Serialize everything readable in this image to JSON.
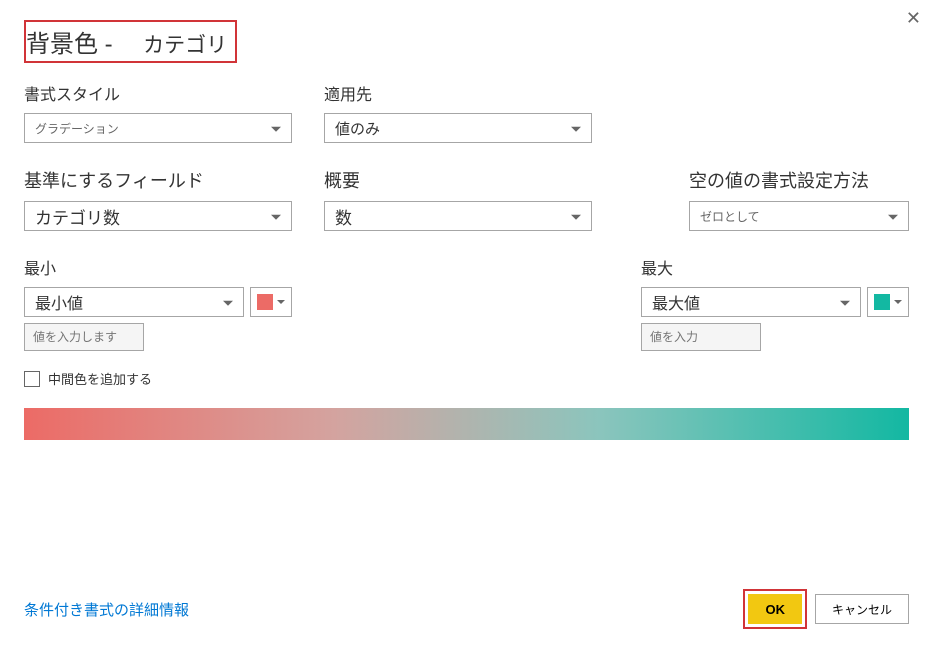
{
  "dialog": {
    "title_main": "背景色 -",
    "title_sub": "カテゴリ"
  },
  "row1": {
    "format_style": {
      "label": "書式スタイル",
      "value": "グラデーション"
    },
    "apply_to": {
      "label": "適用先",
      "value": "値のみ"
    }
  },
  "row2": {
    "base_field": {
      "label": "基準にするフィールド",
      "value": "カテゴリ数"
    },
    "summary": {
      "label": "概要",
      "value": "数"
    },
    "empty_format": {
      "label": "空の値の書式設定方法",
      "value": "ゼロとして"
    }
  },
  "row3": {
    "min": {
      "label": "最小",
      "value": "最小値",
      "input_placeholder": "値を入力します",
      "color": "#ec6b66"
    },
    "max": {
      "label": "最大",
      "value": "最大値",
      "input_placeholder": "値を入力",
      "color": "#13b8a2"
    }
  },
  "checkbox": {
    "label": "中間色を追加する"
  },
  "footer": {
    "link": "条件付き書式の詳細情報",
    "ok": "OK",
    "cancel": "キャンセル"
  }
}
